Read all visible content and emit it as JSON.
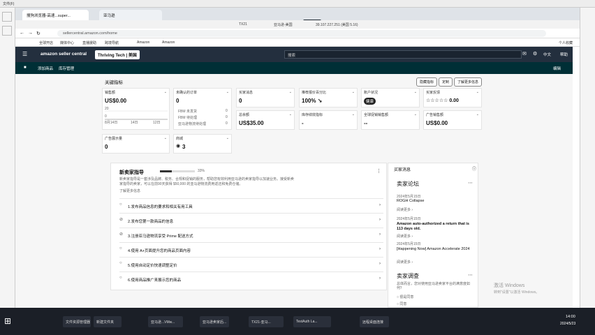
{
  "os": {
    "left_menu": "文件(F)",
    "activate_title": "激活 Windows",
    "activate_sub": "转到\"设置\"以激活 Windows。",
    "tray_time": "14:00",
    "tray_date": "2024/5/23"
  },
  "browser": {
    "tabs": [
      {
        "label": "搜狗浏览器-高速...super..."
      },
      {
        "label": "亚马逊"
      }
    ],
    "address": "sellercentral.amazon.com/home",
    "bookmarks": [
      "全球开店",
      "媒体中心",
      "直播援助",
      "跨境导航",
      "Amazon",
      "Amazon"
    ],
    "right_bookmark": "个人收藏",
    "remote_bar": {
      "left": "TX21",
      "mid": "亚马逊-美国",
      "right": "39.107.227.251 (美国 5.16)",
      "center_icon": "✕"
    }
  },
  "seller_central": {
    "logo": "amazon seller central",
    "account": "Thriving Tech | 美国",
    "search_placeholder": "搜索",
    "lang": "中文",
    "help": "帮助",
    "subnav": [
      "添加商品",
      "库存管理"
    ],
    "subnav_right": "编辑"
  },
  "metrics": {
    "title": "关键指标",
    "buttons": [
      "隐藏指标",
      "定制",
      "了解更多信息"
    ],
    "cards": [
      {
        "label": "销售额",
        "value": "US$0.00"
      },
      {
        "label": "未确认的订单",
        "value": "0"
      },
      {
        "label": "买家消息",
        "value": "0"
      },
      {
        "label": "推荐报价百分比",
        "value": "100% ↘"
      },
      {
        "label": "账户状况",
        "value": "健康"
      },
      {
        "label": "买家反馈",
        "value": "☆☆☆☆☆ 0.00"
      },
      {
        "label": "总余额",
        "value": "US$35.00"
      },
      {
        "label": "库存绩效指标",
        "value": "-"
      },
      {
        "label": "全球促销销售额",
        "value": "--"
      },
      {
        "label": "广告销售额",
        "value": "US$0.00"
      },
      {
        "label": "广告展示量",
        "value": "0"
      },
      {
        "label": "商城",
        "value": "3"
      }
    ],
    "orders_sub": [
      {
        "label": "FBM 未发货",
        "value": "0"
      },
      {
        "label": "FBM 待处理",
        "value": "0"
      },
      {
        "label": "亚马逊物流待处理",
        "value": "0"
      }
    ],
    "chart_axis": [
      "8月14日",
      "14日",
      "12日"
    ],
    "chart_ticks": [
      "20",
      "0"
    ]
  },
  "guide": {
    "title": "新卖家指导",
    "progress_text": "33%",
    "progress": 0.33,
    "desc": "新卖家指导是一套涉及品牌、税务、合规和促销的服务，帮助您有效利用亚马逊的卖家指导以加速业务。接受新卖家指导的卖家，可以在前90天获得 $50,000 的亚马逊物流费用返还和免费仓储。",
    "link": "了解更多信息",
    "items": [
      {
        "mark": "○",
        "label": "1.发布商品信息的要求和相关有用工具"
      },
      {
        "mark": "⊘",
        "label": "2.发布您第一款商品的信息"
      },
      {
        "mark": "⊘",
        "label": "3.注册亚马逊物流享受 Prime 配送方式"
      },
      {
        "mark": "○",
        "label": "4.使用 A+页面提升您的商品页面内容"
      },
      {
        "mark": "○",
        "label": "5.使用自动定价快速调整定价"
      },
      {
        "mark": "○",
        "label": "6.使用商品推广来展示您的商品"
      }
    ]
  },
  "news": {
    "title": "买家消息",
    "forum_title": "卖家论坛",
    "posts": [
      {
        "date": "2024年5月15日",
        "title": "ROGH Collapse",
        "more": "阅读更多 ›"
      },
      {
        "date": "2024年5月15日",
        "title": "Amazon auto-authorized a return that is 113 days old.",
        "more": "阅读更多 ›"
      },
      {
        "date": "2024年5月15日",
        "title": "[Happening Now] Amazon Accelerate 2024",
        "more": "阅读更多 ›"
      }
    ],
    "survey_title": "卖家调查",
    "survey_q": "总体而言，您对使用亚马逊卖家平台的满意度如何？",
    "survey_options": [
      "很是同意",
      "同意"
    ]
  },
  "taskbar": {
    "items": [
      "文件资源管理器",
      "新建文件夹",
      "亚马逊...VMw...",
      "亚马逊卖家后...",
      "TX21-亚马...",
      "TestAuth La...",
      "远程桌面连接"
    ]
  }
}
